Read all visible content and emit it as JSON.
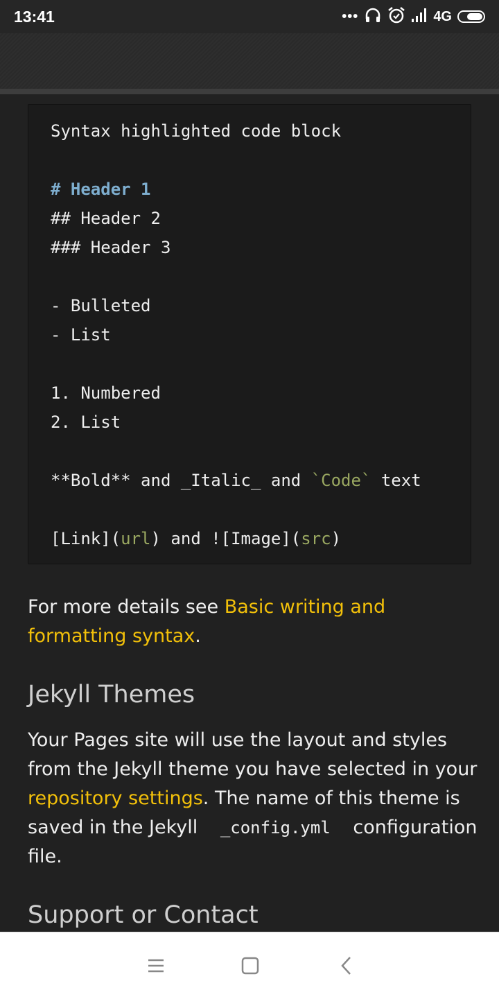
{
  "status_bar": {
    "time": "13:41",
    "network": "4G",
    "icons": [
      "more-dots-icon",
      "headphones-icon",
      "alarm-icon",
      "signal-icon",
      "battery-icon"
    ]
  },
  "code_block": {
    "lines": [
      [
        "Syntax highlighted code block"
      ],
      [
        ""
      ],
      [
        "# Header 1"
      ],
      [
        "## Header 2"
      ],
      [
        "### Header 3"
      ],
      [
        ""
      ],
      [
        "- Bulleted"
      ],
      [
        "- List"
      ],
      [
        ""
      ],
      [
        "1. Numbered"
      ],
      [
        "2. List"
      ],
      [
        ""
      ],
      [
        "**Bold** and _Italic_ and ",
        "`Code`",
        " text"
      ],
      [
        ""
      ],
      [
        "[Link](",
        "url",
        ") and ![Image](",
        "src",
        ")"
      ]
    ]
  },
  "details": {
    "prefix": "For more details see ",
    "link": "Basic writing and formatting syntax",
    "suffix": "."
  },
  "jekyll": {
    "heading": "Jekyll Themes",
    "text1": "Your Pages site will use the layout and styles from the Jekyll theme you have selected in your ",
    "link": "repository settings",
    "text2": ". The name of this theme is saved in the Jekyll ",
    "code": "_config.yml",
    "text3": " configuration file."
  },
  "support": {
    "heading": "Support or Contact"
  },
  "colors": {
    "background": "#212121",
    "link": "#f2c00a",
    "code_header": "#7eaecf",
    "code_string": "#9aa861"
  }
}
